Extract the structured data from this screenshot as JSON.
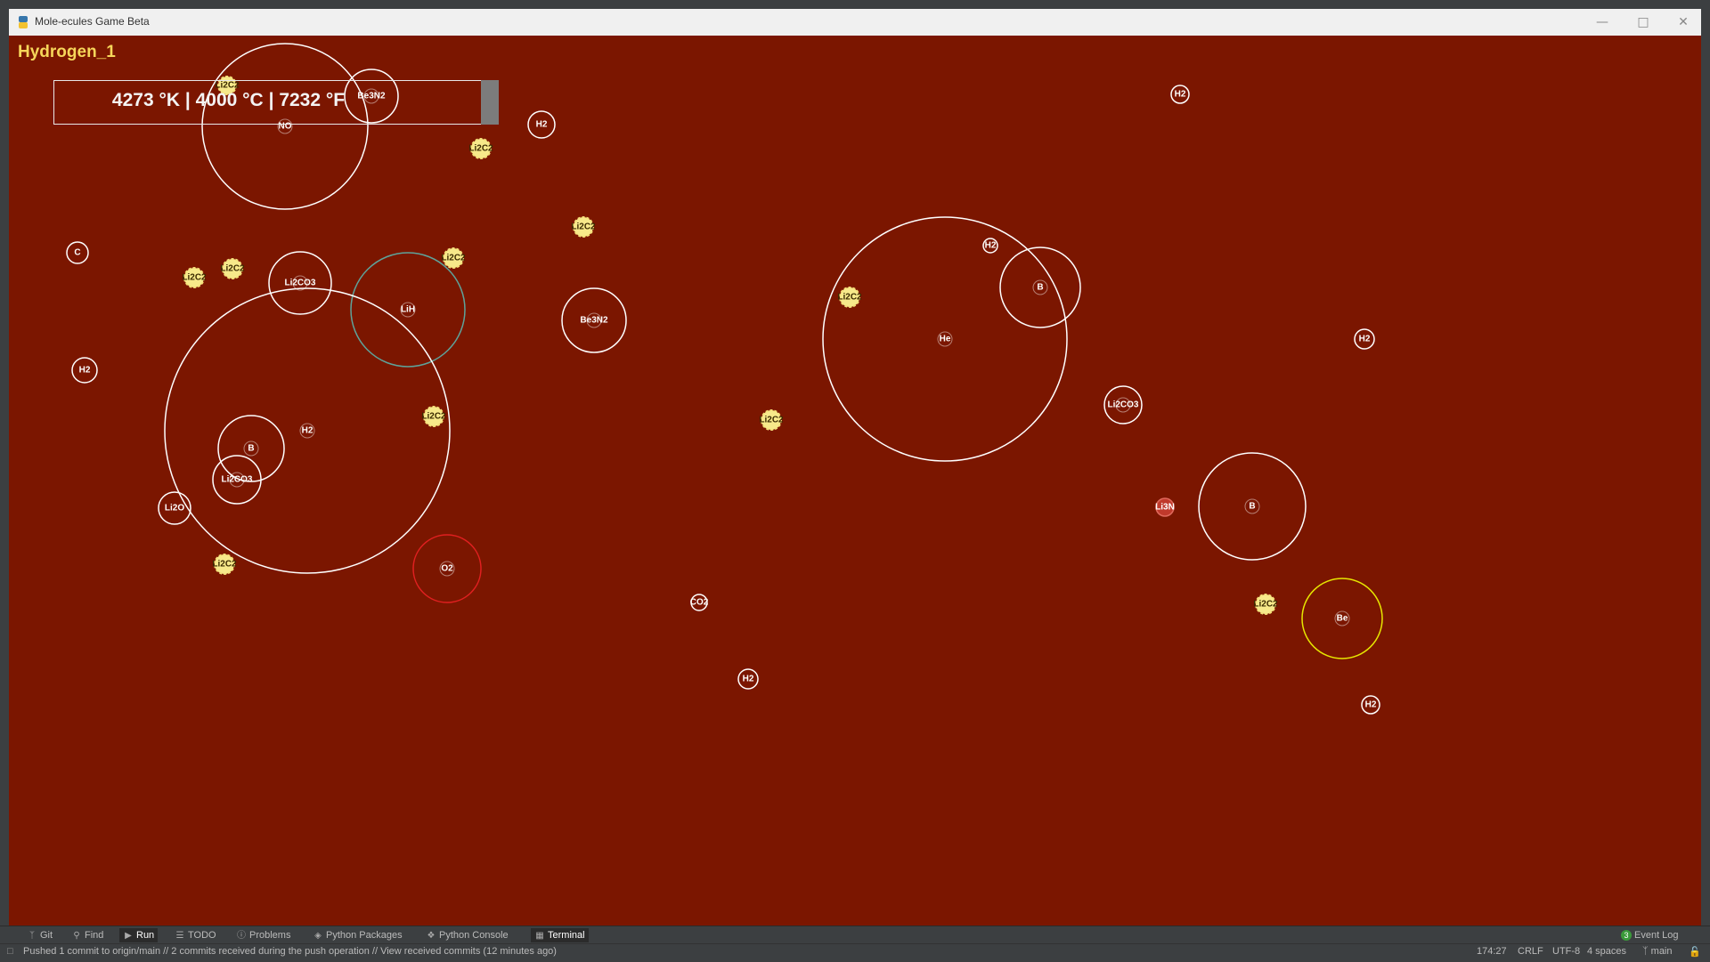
{
  "window": {
    "title": "Mole-ecules Game Beta"
  },
  "game": {
    "level_name": "Hydrogen_1",
    "temperature": {
      "kelvin": "4273 °K",
      "celsius": "4000 °C",
      "fahrenheit": "7232 °F",
      "separator": "|"
    },
    "colors": {
      "background": "#7b1600",
      "title": "#f6d65a",
      "ring_default": "#ffffff",
      "ring_lih": "#5ea39a",
      "ring_o2": "#e02020",
      "ring_be": "#e6e600",
      "li2c2_fill": "#f7e98a",
      "li3n_fill": "#c0392b"
    }
  },
  "toolwindows": {
    "git": "Git",
    "find": "Find",
    "run": "Run",
    "todo": "TODO",
    "problems": "Problems",
    "python_packages": "Python Packages",
    "python_console": "Python Console",
    "terminal": "Terminal",
    "event_log_count": "3",
    "event_log": "Event Log"
  },
  "status": {
    "message": "Pushed 1 commit to origin/main // 2 commits received during the push operation // View received commits (12 minutes ago)",
    "position": "174:27",
    "line_sep": "CRLF",
    "encoding": "UTF-8",
    "indent": "4 spaces",
    "branch": "main"
  }
}
